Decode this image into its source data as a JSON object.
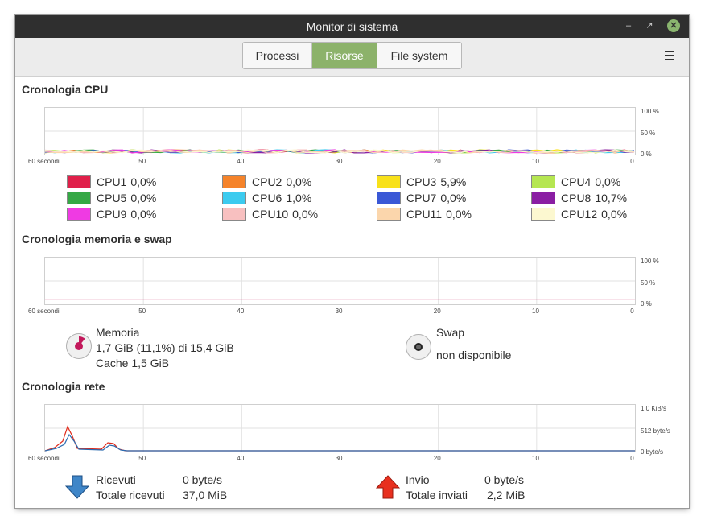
{
  "window": {
    "title": "Monitor di sistema"
  },
  "tabs": [
    {
      "label": "Processi",
      "active": false
    },
    {
      "label": "Risorse",
      "active": true
    },
    {
      "label": "File system",
      "active": false
    }
  ],
  "cpu": {
    "title": "Cronologia CPU",
    "y_labels": [
      "100 %",
      "50 %",
      "0 %"
    ],
    "x_labels": [
      "60 secondi",
      "50",
      "40",
      "30",
      "20",
      "10",
      "0"
    ],
    "cores": [
      {
        "name": "CPU1",
        "value": "0,0%",
        "color": "#e0204a"
      },
      {
        "name": "CPU2",
        "value": "0,0%",
        "color": "#f5832a"
      },
      {
        "name": "CPU3",
        "value": "5,9%",
        "color": "#f8e11a"
      },
      {
        "name": "CPU4",
        "value": "0,0%",
        "color": "#b5e651"
      },
      {
        "name": "CPU5",
        "value": "0,0%",
        "color": "#35a845"
      },
      {
        "name": "CPU6",
        "value": "1,0%",
        "color": "#3ccbef"
      },
      {
        "name": "CPU7",
        "value": "0,0%",
        "color": "#3a58d6"
      },
      {
        "name": "CPU8",
        "value": "10,7%",
        "color": "#8a1ea3"
      },
      {
        "name": "CPU9",
        "value": "0,0%",
        "color": "#ef3ae3"
      },
      {
        "name": "CPU10",
        "value": "0,0%",
        "color": "#f8c0c0"
      },
      {
        "name": "CPU11",
        "value": "0,0%",
        "color": "#fbd6ac"
      },
      {
        "name": "CPU12",
        "value": "0,0%",
        "color": "#fcf8d0"
      }
    ]
  },
  "memory": {
    "title": "Cronologia memoria e swap",
    "y_labels": [
      "100 %",
      "50 %",
      "0 %"
    ],
    "x_labels": [
      "60 secondi",
      "50",
      "40",
      "30",
      "20",
      "10",
      "0"
    ],
    "mem_label": "Memoria",
    "mem_usage": "1,7 GiB (11,1%) di 15,4 GiB",
    "mem_cache": "Cache 1,5 GiB",
    "mem_fraction": 0.111,
    "mem_color": "#c2185b",
    "swap_label": "Swap",
    "swap_status": "non disponibile"
  },
  "network": {
    "title": "Cronologia rete",
    "y_labels": [
      "1,0 KiB/s",
      "512 byte/s",
      "0 byte/s"
    ],
    "x_labels": [
      "60 secondi",
      "50",
      "40",
      "30",
      "20",
      "10",
      "0"
    ],
    "received_label": "Ricevuti",
    "received_value": "0 byte/s",
    "total_received_label": "Totale ricevuti",
    "total_received_value": "37,0 MiB",
    "sent_label": "Invio",
    "sent_value": "0 byte/s",
    "total_sent_label": "Totale inviati",
    "total_sent_value": "2,2 MiB",
    "received_color": "#2b6bb0",
    "sent_color": "#e02a1a"
  }
}
